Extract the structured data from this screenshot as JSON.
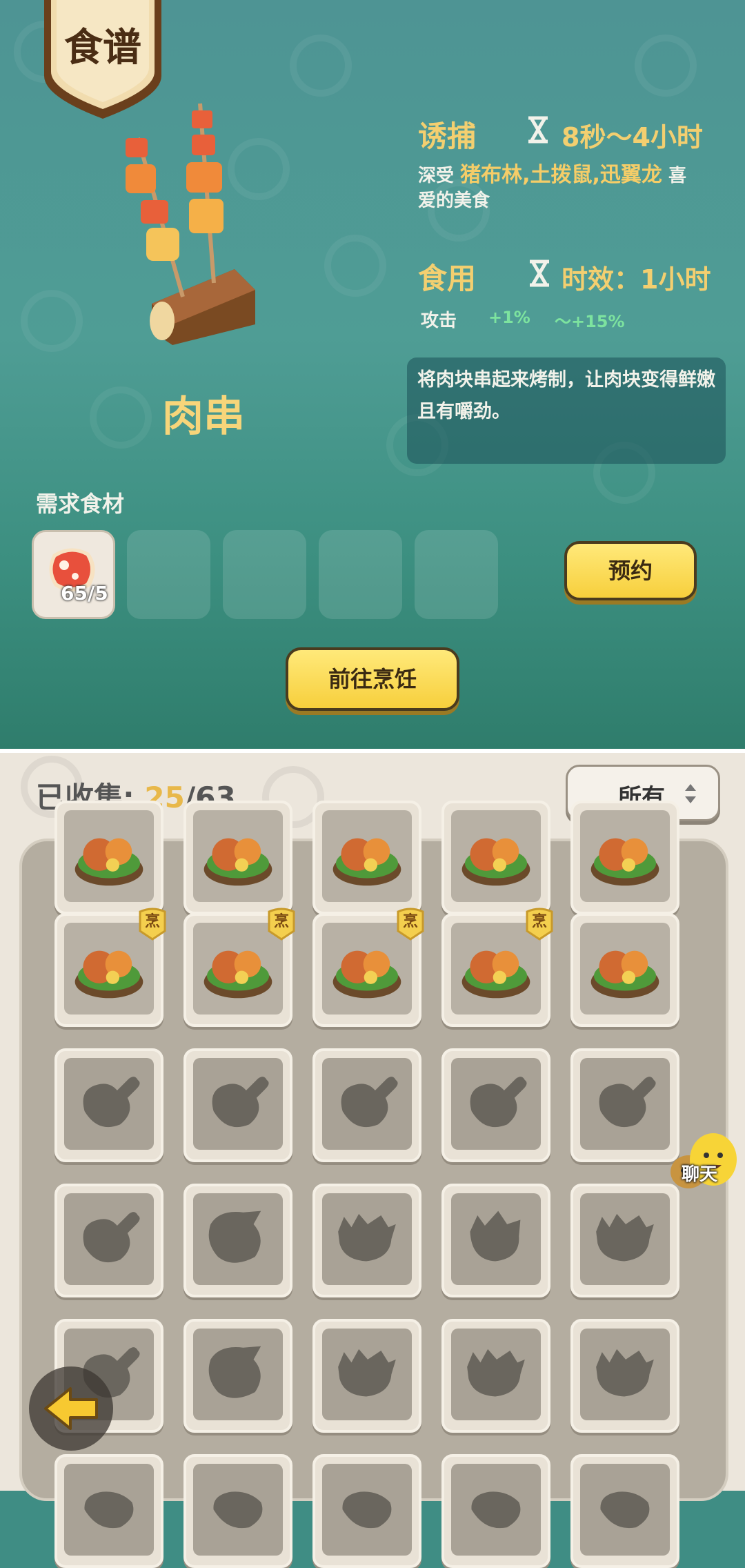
{
  "header": {
    "banner_title": "食谱"
  },
  "dish": {
    "name": "肉串"
  },
  "lure": {
    "label": "诱捕",
    "duration": "8秒～4小时",
    "desc_prefix": "深受",
    "desc_creatures": "猪布林,土拨鼠,迅翼龙",
    "desc_suffix": "喜",
    "desc_line2": "爱的美食"
  },
  "eat": {
    "label": "食用",
    "duration": "时效：1小时",
    "stat_name": "攻击",
    "stat_min": "+1%",
    "stat_max": "～+15%"
  },
  "description": "将肉块串起来烤制，让肉块变得鲜嫩且有嚼劲。",
  "ingredients": {
    "label": "需求食材",
    "slots": [
      {
        "item": "meat",
        "count": "65/5"
      },
      {},
      {},
      {},
      {}
    ]
  },
  "buttons": {
    "reserve": "预约",
    "go_cook": "前往烹饪"
  },
  "collection": {
    "prefix": "已收集:",
    "collected": "25",
    "total": "/63",
    "filter": "所有"
  },
  "grid": {
    "badge": "烹",
    "rows": [
      [
        "cooked",
        "cooked",
        "cooked",
        "cooked",
        "cooked"
      ],
      [
        "cooked-badge",
        "cooked-badge",
        "cooked-badge",
        "cooked-badge",
        "cooked"
      ],
      [
        "locked-meat",
        "locked-meat",
        "locked-meat",
        "locked-meat",
        "locked-meat"
      ],
      [
        "locked-meat",
        "locked-roast",
        "locked-crab",
        "locked-dino",
        "locked-crab"
      ],
      [
        "locked-meat",
        "locked-roast",
        "locked-crab",
        "locked-crab",
        "locked-crab"
      ],
      [
        "locked",
        "locked",
        "locked",
        "locked",
        "locked"
      ]
    ]
  },
  "chat": {
    "label": "聊天"
  },
  "colors": {
    "accent": "#f5cd68",
    "gain": "#78e0a0",
    "button": "#f7cf3c",
    "panel": "#b4ada0"
  }
}
